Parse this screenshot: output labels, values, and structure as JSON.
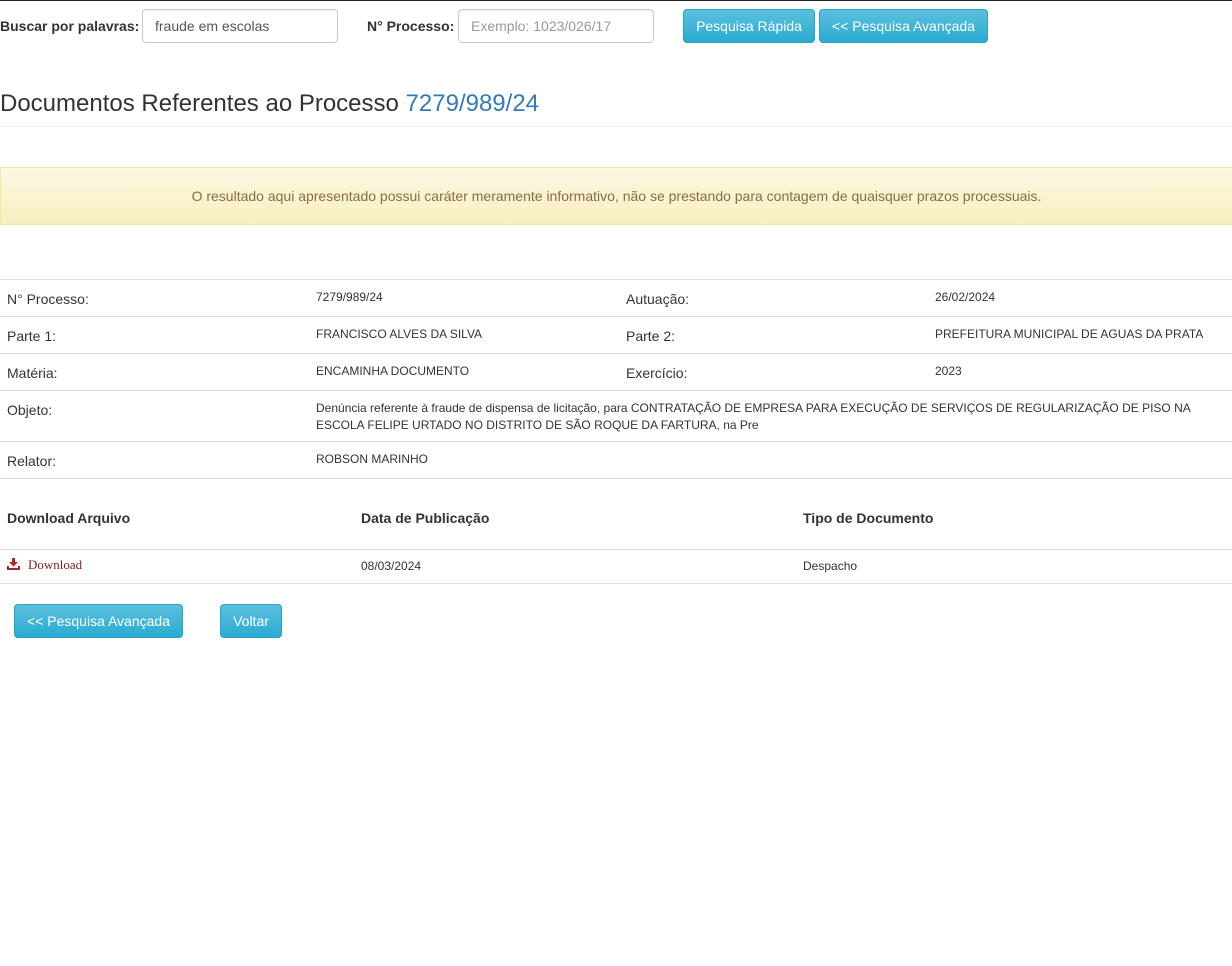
{
  "search": {
    "keywords_label": "Buscar por palavras:",
    "keywords_value": "fraude em escolas",
    "process_label": "N° Processo:",
    "process_placeholder": "Exemplo: 1023/026/17",
    "quick_button": "Pesquisa Rápida",
    "advanced_button": "<< Pesquisa Avançada"
  },
  "header": {
    "title_prefix": "Documentos Referentes ao Processo",
    "process_number": "7279/989/24"
  },
  "alert": {
    "text": "O resultado aqui apresentado possui caráter meramente informativo, não se prestando para contagem de quaisquer prazos processuais."
  },
  "details": {
    "process_label": "N° Processo:",
    "process_value": "7279/989/24",
    "actuation_label": "Autuação:",
    "actuation_value": "26/02/2024",
    "party1_label": "Parte 1:",
    "party1_value": "FRANCISCO ALVES DA SILVA",
    "party2_label": "Parte 2:",
    "party2_value": "PREFEITURA MUNICIPAL DE AGUAS DA PRATA",
    "subject_label": "Matéria:",
    "subject_value": "ENCAMINHA DOCUMENTO",
    "year_label": "Exercício:",
    "year_value": "2023",
    "object_label": "Objeto:",
    "object_value": "Denúncia referente à fraude de dispensa de licitação, para CONTRATAÇÃO DE EMPRESA PARA EXECUÇÃO DE SERVIÇOS DE REGULARIZAÇÃO DE PISO NA ESCOLA FELIPE URTADO NO DISTRITO DE SÃO ROQUE DA FARTURA, na Pre",
    "rapporteur_label": "Relator:",
    "rapporteur_value": "ROBSON MARINHO"
  },
  "documents": {
    "columns": [
      "Download Arquivo",
      "Data de Publicação",
      "Tipo de Documento"
    ],
    "rows": [
      {
        "download": "Download",
        "date": "08/03/2024",
        "type": "Despacho"
      }
    ]
  },
  "footer": {
    "advanced_button": "<< Pesquisa Avançada",
    "back_button": "Voltar"
  },
  "colors": {
    "button": "#5bc0de",
    "link_number": "#337ab7",
    "alert_bg": "#fcf8e3",
    "alert_text": "#8a6d3b",
    "download_icon": "#a52a2a"
  }
}
